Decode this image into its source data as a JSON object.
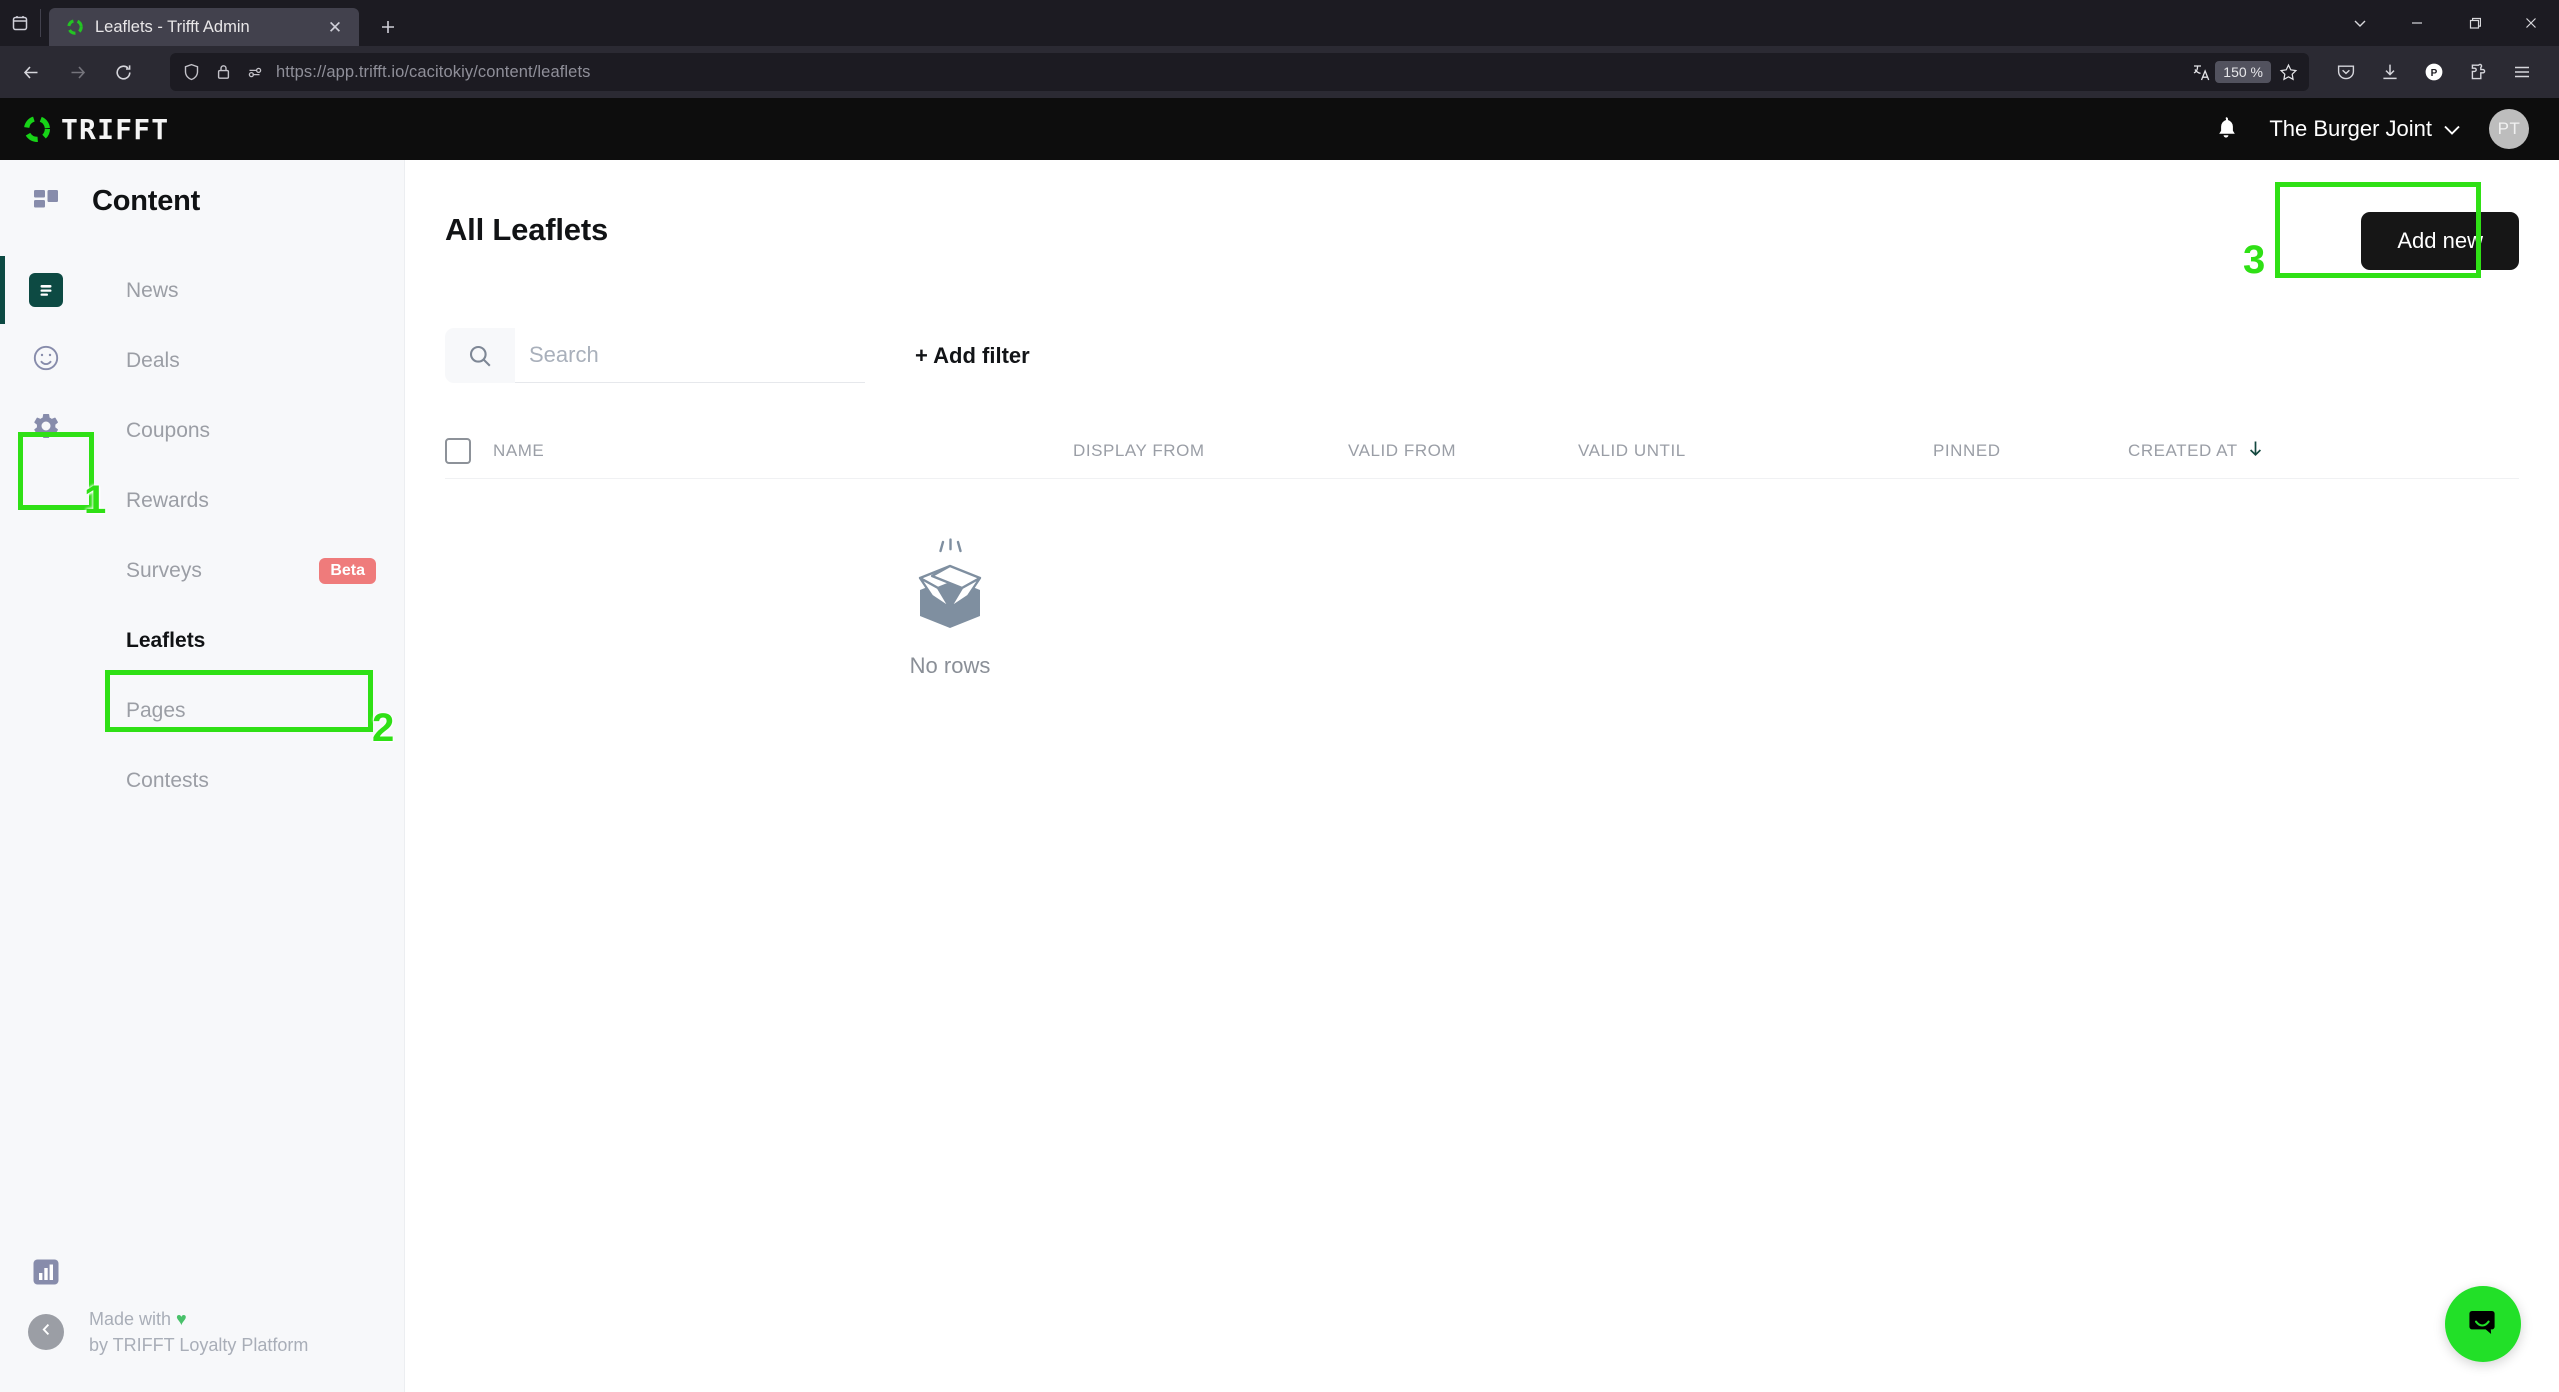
{
  "browser": {
    "tab": {
      "title": "Leaflets - Trifft Admin",
      "favicon_icon": "trifft-ring-icon",
      "close_icon": "close-icon"
    },
    "new_tab_icon": "plus-icon",
    "list_all_tabs_icon": "list-all-tabs-icon",
    "back_icon": "back-arrow-icon",
    "forward_icon": "forward-arrow-icon",
    "reload_icon": "reload-icon",
    "url": {
      "scheme": "https://app.",
      "domain": "trifft.io",
      "path": "/cacitokiy/content/leaflets",
      "full": "https://app.trifft.io/cacitokiy/content/leaflets"
    },
    "shield_icon": "shield-icon",
    "lock_icon": "padlock-icon",
    "permissions_icon": "page-permissions-icon",
    "translate_icon": "translate-icon",
    "zoom_level": "150 %",
    "bookmark_icon": "star-icon",
    "pocket_icon": "pocket-icon",
    "downloads_icon": "download-icon",
    "profile_icon": "profile-icon",
    "profile_letter": "P",
    "extensions_icon": "extensions-icon",
    "menu_icon": "hamburger-menu-icon",
    "window": {
      "minimize": "minimize-icon",
      "maximize": "maximize-icon",
      "close": "close-icon",
      "chevron": "chevron-down-icon"
    }
  },
  "appbar": {
    "logo_text": "TRIFFT",
    "logo_mark": "trifft-ring-icon",
    "notifications_icon": "bell-icon",
    "tenant_name": "The Burger Joint",
    "tenant_chevron": "chevron-down-icon",
    "avatar_initials": "PT"
  },
  "sidebar": {
    "title": "Content",
    "rail": [
      {
        "name": "dashboard-icon",
        "active": false
      },
      {
        "name": "content-icon",
        "active": true
      },
      {
        "name": "engagement-smiley-icon",
        "active": false
      },
      {
        "name": "settings-gear-icon",
        "active": false
      }
    ],
    "rail_bottom": {
      "name": "analytics-bar-chart-icon"
    },
    "items": [
      {
        "label": "News",
        "badge": "",
        "active": false
      },
      {
        "label": "Deals",
        "badge": "",
        "active": false
      },
      {
        "label": "Coupons",
        "badge": "",
        "active": false
      },
      {
        "label": "Rewards",
        "badge": "",
        "active": false
      },
      {
        "label": "Surveys",
        "badge": "Beta",
        "active": false
      },
      {
        "label": "Leaflets",
        "badge": "",
        "active": true
      },
      {
        "label": "Pages",
        "badge": "",
        "active": false
      },
      {
        "label": "Contests",
        "badge": "",
        "active": false
      }
    ],
    "collapse_icon": "chevron-left-icon",
    "footer_line1_pre": "Made with ",
    "footer_heart": "♥",
    "footer_line2": "by TRIFFT Loyalty Platform"
  },
  "main": {
    "page_title": "All Leaflets",
    "add_new_label": "Add new",
    "search": {
      "placeholder": "Search",
      "value": "",
      "icon": "search-icon"
    },
    "add_filter_label": "+ Add filter",
    "table": {
      "select_all_checkbox": "select-all-checkbox",
      "columns": [
        {
          "label": "NAME",
          "sorted": false
        },
        {
          "label": "DISPLAY FROM",
          "sorted": false
        },
        {
          "label": "VALID FROM",
          "sorted": false
        },
        {
          "label": "VALID UNTIL",
          "sorted": false
        },
        {
          "label": "PINNED",
          "sorted": false
        },
        {
          "label": "CREATED AT",
          "sorted": true,
          "sort_icon": "arrow-down-icon"
        }
      ],
      "rows": [],
      "empty_label": "No rows",
      "empty_icon": "empty-box-icon"
    }
  },
  "annotations": [
    {
      "id": "1",
      "target": "sidebar-rail-content-icon"
    },
    {
      "id": "2",
      "target": "sidebar-item-leaflets"
    },
    {
      "id": "3",
      "target": "add-new-button"
    }
  ],
  "intercom": {
    "icon": "chat-bubble-icon",
    "color": "#22e028"
  },
  "colors": {
    "accent_green": "#2fe015",
    "brand_dark": "#0d4a43",
    "badge_beta": "#ef7b7b",
    "button_dark": "#161616"
  }
}
